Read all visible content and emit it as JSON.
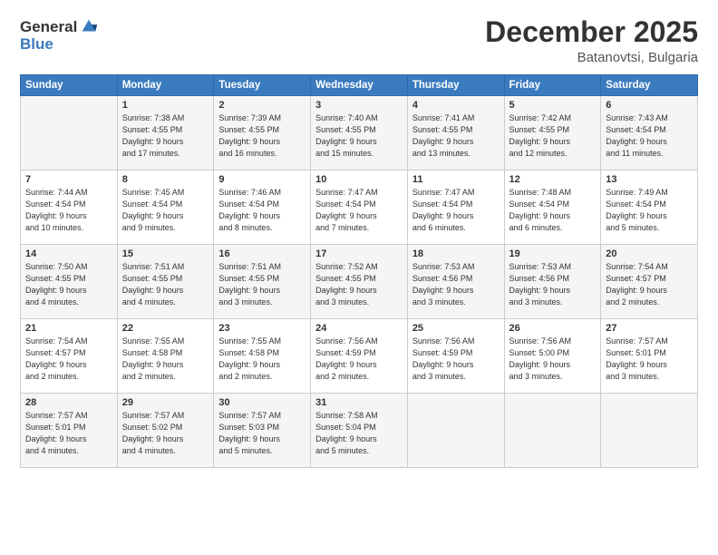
{
  "logo": {
    "general": "General",
    "blue": "Blue"
  },
  "title": "December 2025",
  "location": "Batanovtsi, Bulgaria",
  "days_header": [
    "Sunday",
    "Monday",
    "Tuesday",
    "Wednesday",
    "Thursday",
    "Friday",
    "Saturday"
  ],
  "weeks": [
    [
      {
        "day": "",
        "info": ""
      },
      {
        "day": "1",
        "info": "Sunrise: 7:38 AM\nSunset: 4:55 PM\nDaylight: 9 hours\nand 17 minutes."
      },
      {
        "day": "2",
        "info": "Sunrise: 7:39 AM\nSunset: 4:55 PM\nDaylight: 9 hours\nand 16 minutes."
      },
      {
        "day": "3",
        "info": "Sunrise: 7:40 AM\nSunset: 4:55 PM\nDaylight: 9 hours\nand 15 minutes."
      },
      {
        "day": "4",
        "info": "Sunrise: 7:41 AM\nSunset: 4:55 PM\nDaylight: 9 hours\nand 13 minutes."
      },
      {
        "day": "5",
        "info": "Sunrise: 7:42 AM\nSunset: 4:55 PM\nDaylight: 9 hours\nand 12 minutes."
      },
      {
        "day": "6",
        "info": "Sunrise: 7:43 AM\nSunset: 4:54 PM\nDaylight: 9 hours\nand 11 minutes."
      }
    ],
    [
      {
        "day": "7",
        "info": "Sunrise: 7:44 AM\nSunset: 4:54 PM\nDaylight: 9 hours\nand 10 minutes."
      },
      {
        "day": "8",
        "info": "Sunrise: 7:45 AM\nSunset: 4:54 PM\nDaylight: 9 hours\nand 9 minutes."
      },
      {
        "day": "9",
        "info": "Sunrise: 7:46 AM\nSunset: 4:54 PM\nDaylight: 9 hours\nand 8 minutes."
      },
      {
        "day": "10",
        "info": "Sunrise: 7:47 AM\nSunset: 4:54 PM\nDaylight: 9 hours\nand 7 minutes."
      },
      {
        "day": "11",
        "info": "Sunrise: 7:47 AM\nSunset: 4:54 PM\nDaylight: 9 hours\nand 6 minutes."
      },
      {
        "day": "12",
        "info": "Sunrise: 7:48 AM\nSunset: 4:54 PM\nDaylight: 9 hours\nand 6 minutes."
      },
      {
        "day": "13",
        "info": "Sunrise: 7:49 AM\nSunset: 4:54 PM\nDaylight: 9 hours\nand 5 minutes."
      }
    ],
    [
      {
        "day": "14",
        "info": "Sunrise: 7:50 AM\nSunset: 4:55 PM\nDaylight: 9 hours\nand 4 minutes."
      },
      {
        "day": "15",
        "info": "Sunrise: 7:51 AM\nSunset: 4:55 PM\nDaylight: 9 hours\nand 4 minutes."
      },
      {
        "day": "16",
        "info": "Sunrise: 7:51 AM\nSunset: 4:55 PM\nDaylight: 9 hours\nand 3 minutes."
      },
      {
        "day": "17",
        "info": "Sunrise: 7:52 AM\nSunset: 4:55 PM\nDaylight: 9 hours\nand 3 minutes."
      },
      {
        "day": "18",
        "info": "Sunrise: 7:53 AM\nSunset: 4:56 PM\nDaylight: 9 hours\nand 3 minutes."
      },
      {
        "day": "19",
        "info": "Sunrise: 7:53 AM\nSunset: 4:56 PM\nDaylight: 9 hours\nand 3 minutes."
      },
      {
        "day": "20",
        "info": "Sunrise: 7:54 AM\nSunset: 4:57 PM\nDaylight: 9 hours\nand 2 minutes."
      }
    ],
    [
      {
        "day": "21",
        "info": "Sunrise: 7:54 AM\nSunset: 4:57 PM\nDaylight: 9 hours\nand 2 minutes."
      },
      {
        "day": "22",
        "info": "Sunrise: 7:55 AM\nSunset: 4:58 PM\nDaylight: 9 hours\nand 2 minutes."
      },
      {
        "day": "23",
        "info": "Sunrise: 7:55 AM\nSunset: 4:58 PM\nDaylight: 9 hours\nand 2 minutes."
      },
      {
        "day": "24",
        "info": "Sunrise: 7:56 AM\nSunset: 4:59 PM\nDaylight: 9 hours\nand 2 minutes."
      },
      {
        "day": "25",
        "info": "Sunrise: 7:56 AM\nSunset: 4:59 PM\nDaylight: 9 hours\nand 3 minutes."
      },
      {
        "day": "26",
        "info": "Sunrise: 7:56 AM\nSunset: 5:00 PM\nDaylight: 9 hours\nand 3 minutes."
      },
      {
        "day": "27",
        "info": "Sunrise: 7:57 AM\nSunset: 5:01 PM\nDaylight: 9 hours\nand 3 minutes."
      }
    ],
    [
      {
        "day": "28",
        "info": "Sunrise: 7:57 AM\nSunset: 5:01 PM\nDaylight: 9 hours\nand 4 minutes."
      },
      {
        "day": "29",
        "info": "Sunrise: 7:57 AM\nSunset: 5:02 PM\nDaylight: 9 hours\nand 4 minutes."
      },
      {
        "day": "30",
        "info": "Sunrise: 7:57 AM\nSunset: 5:03 PM\nDaylight: 9 hours\nand 5 minutes."
      },
      {
        "day": "31",
        "info": "Sunrise: 7:58 AM\nSunset: 5:04 PM\nDaylight: 9 hours\nand 5 minutes."
      },
      {
        "day": "",
        "info": ""
      },
      {
        "day": "",
        "info": ""
      },
      {
        "day": "",
        "info": ""
      }
    ]
  ]
}
